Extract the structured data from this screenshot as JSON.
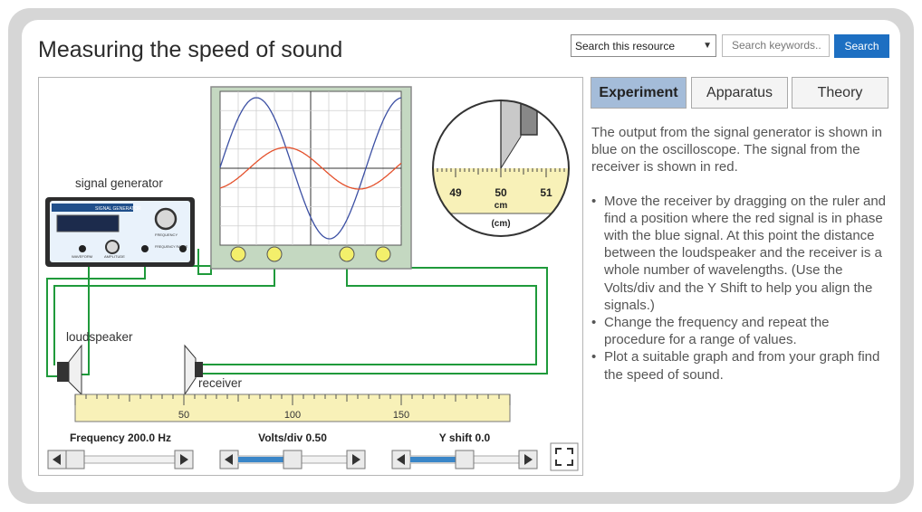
{
  "page": {
    "title": "Measuring the speed of sound"
  },
  "search": {
    "select_value": "Search this resource",
    "placeholder": "Search keywords..",
    "button_label": "Search"
  },
  "tabs": [
    {
      "label": "Experiment",
      "active": true
    },
    {
      "label": "Apparatus",
      "active": false
    },
    {
      "label": "Theory",
      "active": false
    }
  ],
  "instructions": {
    "intro": "The output from the signal generator is shown in blue on the oscilloscope. The signal from the receiver is shown in red.",
    "bullets": [
      "Move the receiver by dragging on the ruler and find a position where the red signal is in phase with the blue signal. At this point the distance between the loudspeaker and the receiver is a whole number of wavelengths. (Use the Volts/div and the Y Shift to help you align the signals.)",
      "Change the frequency and repeat the procedure for a range of values.",
      "Plot a suitable graph and from your graph find the speed of sound."
    ]
  },
  "simulation": {
    "labels": {
      "signal_generator": "signal generator",
      "loudspeaker": "loudspeaker",
      "receiver": "receiver",
      "generator_panel_text": "SIGNAL GENERATOR",
      "generator_frequency_text": "FREQUENCY",
      "generator_waveform_text": "WAVEFORM",
      "generator_amplitude_text": "AMPLITUDE",
      "generator_frequency_range_text": "FREQUENCY RANGE"
    },
    "ruler": {
      "tick_labels": [
        "50",
        "100",
        "150"
      ]
    },
    "magnifier": {
      "tick_labels": [
        "49",
        "50",
        "51"
      ],
      "unit_label": "cm",
      "caption": "(cm)",
      "reading_cm": 50
    },
    "controls": {
      "frequency": {
        "label": "Frequency 200.0 Hz",
        "fraction": 0.0
      },
      "volts_div": {
        "label": "Volts/div 0.50",
        "fraction": 0.5
      },
      "y_shift": {
        "label": "Y shift 0.0",
        "fraction": 0.5
      }
    },
    "colors": {
      "blue_signal": "#3b4fa3",
      "red_signal": "#e4502b",
      "wire": "#1f9a3b",
      "scope_frame": "#c4d8c1",
      "ruler": "#f8f1b8",
      "control_track": "#3a86c8"
    },
    "icons": {
      "fullscreen": "fullscreen-icon"
    }
  }
}
